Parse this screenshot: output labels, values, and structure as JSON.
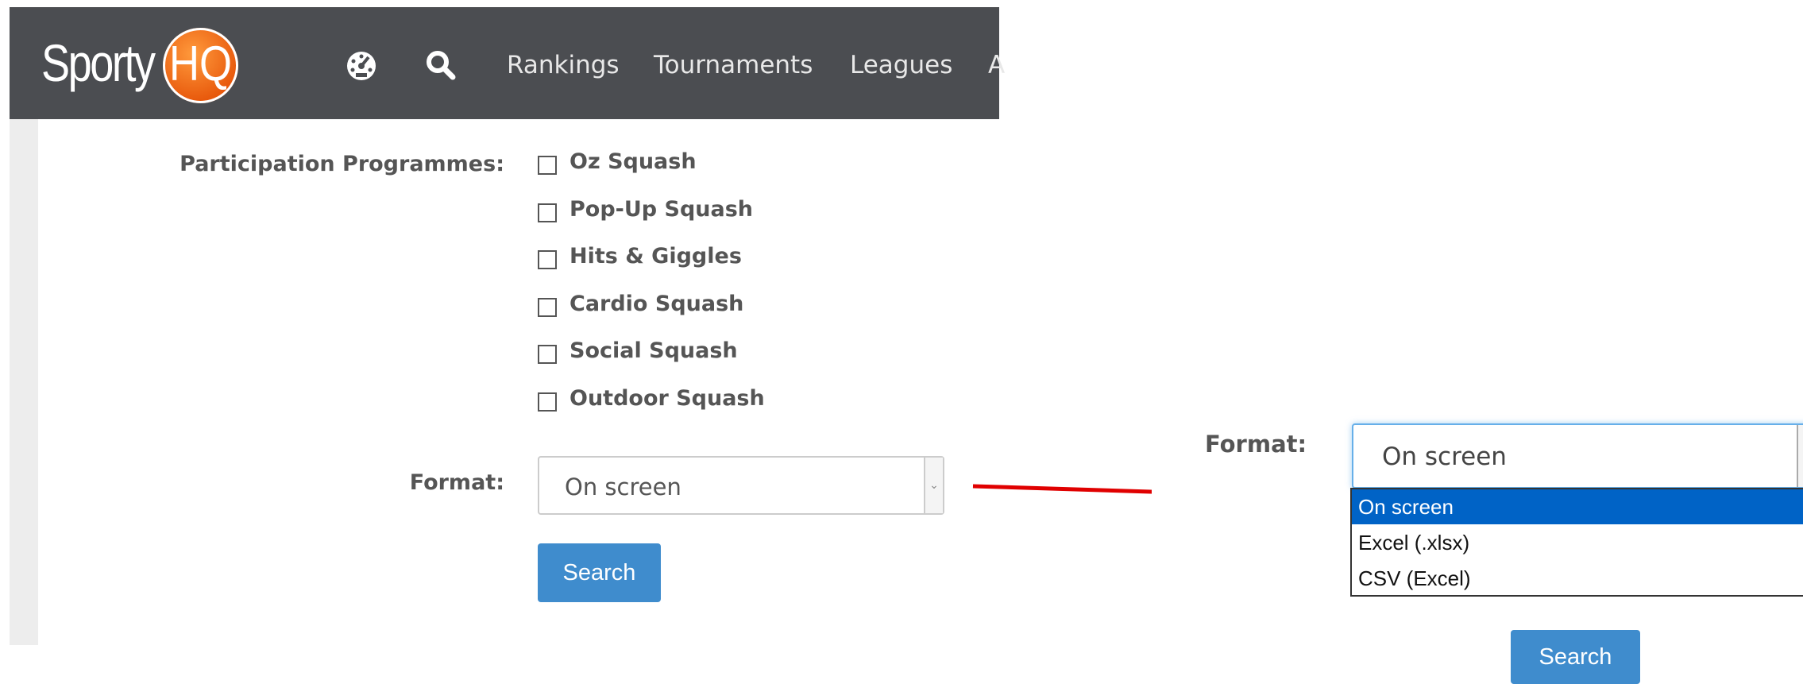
{
  "navbar": {
    "logo_text": "Sporty",
    "logo_badge": "HQ",
    "icons": [
      "dashboard-icon",
      "search-icon"
    ],
    "links": [
      "Rankings",
      "Tournaments",
      "Leagues",
      "A"
    ]
  },
  "form": {
    "participation_label": "Participation Programmes:",
    "programmes": [
      "Oz Squash",
      "Pop-Up Squash",
      "Hits & Giggles",
      "Cardio Squash",
      "Social Squash",
      "Outdoor Squash"
    ],
    "format_label": "Format:",
    "format_value": "On screen",
    "search_label": "Search"
  },
  "zoomed": {
    "format_label": "Format:",
    "format_value": "On screen",
    "options": [
      "On screen",
      "Excel (.xlsx)",
      "CSV (Excel)"
    ],
    "selected_option": "On screen",
    "search_label": "Search"
  },
  "colors": {
    "navbar": "#4b4d51",
    "accent": "#3f8ccd",
    "selected_option": "#0063c6",
    "arrow": "#e00000",
    "logo_badge": "#e8590c"
  }
}
